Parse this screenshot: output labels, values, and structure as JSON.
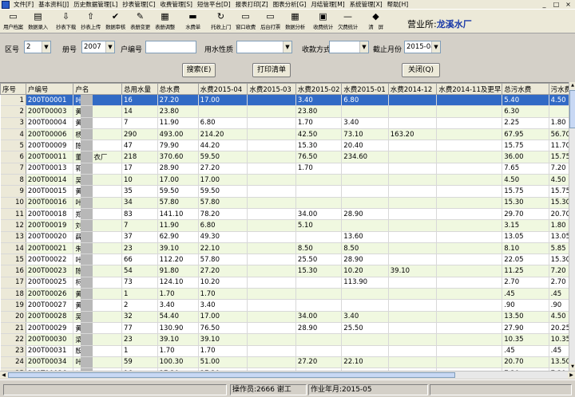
{
  "menu": [
    "文件[F]",
    "基本资料[J]",
    "历史数据管理[L]",
    "抄表管理[C]",
    "收费管理[S]",
    "短信平台[D]",
    "报表打印[Z]",
    "图表分析[G]",
    "月结管理[M]",
    "系统管理[X]",
    "帮助[H]"
  ],
  "window_buttons": [
    "_",
    "□",
    "×"
  ],
  "toolbar": [
    {
      "icon": "user-file-icon",
      "glyph": "▭",
      "label": "用户档案"
    },
    {
      "icon": "data-entry-icon",
      "glyph": "▤",
      "label": "数据录入"
    },
    {
      "icon": "download-icon",
      "glyph": "⇩",
      "label": "抄表下载"
    },
    {
      "icon": "upload-icon",
      "glyph": "⇧",
      "label": "抄表上传"
    },
    {
      "icon": "audit-icon",
      "glyph": "✔",
      "label": "数据审核"
    },
    {
      "icon": "table-change-icon",
      "glyph": "✎",
      "label": "表册变更"
    },
    {
      "icon": "table-adjust-icon",
      "glyph": "▦",
      "label": "表册调整"
    },
    {
      "icon": "water-bill-icon",
      "glyph": "▬",
      "label": "水费单"
    },
    {
      "icon": "door-to-door-icon",
      "glyph": "↻",
      "label": "托收上门"
    },
    {
      "icon": "window-charge-icon",
      "glyph": "▭",
      "label": "窗口收费"
    },
    {
      "icon": "backend-print-icon",
      "glyph": "▭",
      "label": "后台打票"
    },
    {
      "icon": "data-analysis-icon",
      "glyph": "▦",
      "label": "数据分析"
    },
    {
      "icon": "charge-stats-icon",
      "glyph": "▣",
      "label": "收费统计"
    },
    {
      "icon": "arrears-stats-icon",
      "glyph": "—",
      "label": "欠费统计"
    },
    {
      "icon": "clear-screen-icon",
      "glyph": "◆",
      "label": "清　屏"
    }
  ],
  "company": {
    "prefix": "营业所:",
    "name": "龙溪水厂"
  },
  "filters": {
    "district_label": "区号",
    "district_value": "2",
    "book_label": "册号",
    "book_value": "2007",
    "user_no_label": "户编号",
    "user_no_value": "",
    "water_type_label": "用水性质",
    "water_type_value": "",
    "pay_method_label": "收款方式",
    "pay_method_value": "",
    "month_label": "截止月份",
    "month_value": "2015-04"
  },
  "buttons": {
    "search": "搜索(E)",
    "print": "打印清单",
    "close": "关闭(Q)"
  },
  "table": {
    "columns": [
      "序号",
      "户编号",
      "户名",
      "总用水量",
      "总水费",
      "水费2015-04",
      "水费2015-03",
      "水费2015-02",
      "水费2015-01",
      "水费2014-12",
      "水费2014-11及更早",
      "总污水费",
      "污水费2015-0"
    ],
    "rows": [
      [
        "1",
        "200T00001",
        "叶",
        "16",
        "27.20",
        "17.00",
        "",
        "3.40",
        "6.80",
        "",
        "",
        "5.40",
        "4.50"
      ],
      [
        "2",
        "200T00003",
        "黄",
        "14",
        "23.80",
        "",
        "",
        "23.80",
        "",
        "",
        "",
        "6.30",
        ""
      ],
      [
        "3",
        "200T00004",
        "黄",
        "7",
        "11.90",
        "6.80",
        "",
        "1.70",
        "3.40",
        "",
        "",
        "2.25",
        "1.80"
      ],
      [
        "4",
        "200T00006",
        "杨",
        "290",
        "493.00",
        "214.20",
        "",
        "42.50",
        "73.10",
        "163.20",
        "",
        "67.95",
        "56.70"
      ],
      [
        "5",
        "200T00009",
        "陈",
        "47",
        "79.90",
        "44.20",
        "",
        "15.30",
        "20.40",
        "",
        "",
        "15.75",
        "11.70"
      ],
      [
        "6",
        "200T00011",
        "董",
        "218",
        "370.60",
        "59.50",
        "",
        "76.50",
        "234.60",
        "",
        "",
        "36.00",
        "15.75"
      ],
      [
        "7",
        "200T00013",
        "郭",
        "17",
        "28.90",
        "27.20",
        "",
        "1.70",
        "",
        "",
        "",
        "7.65",
        "7.20"
      ],
      [
        "8",
        "200T00014",
        "吴",
        "10",
        "17.00",
        "17.00",
        "",
        "",
        "",
        "",
        "",
        "4.50",
        "4.50"
      ],
      [
        "9",
        "200T00015",
        "黄",
        "35",
        "59.50",
        "59.50",
        "",
        "",
        "",
        "",
        "",
        "15.75",
        "15.75"
      ],
      [
        "10",
        "200T00016",
        "叶",
        "34",
        "57.80",
        "57.80",
        "",
        "",
        "",
        "",
        "",
        "15.30",
        "15.30"
      ],
      [
        "11",
        "200T00018",
        "郑",
        "83",
        "141.10",
        "78.20",
        "",
        "34.00",
        "28.90",
        "",
        "",
        "29.70",
        "20.70"
      ],
      [
        "12",
        "200T00019",
        "刘",
        "7",
        "11.90",
        "6.80",
        "",
        "5.10",
        "",
        "",
        "",
        "3.15",
        "1.80"
      ],
      [
        "13",
        "200T00020",
        "薛",
        "37",
        "62.90",
        "49.30",
        "",
        "",
        "13.60",
        "",
        "",
        "13.05",
        "13.05"
      ],
      [
        "14",
        "200T00021",
        "朱",
        "23",
        "39.10",
        "22.10",
        "",
        "8.50",
        "8.50",
        "",
        "",
        "8.10",
        "5.85"
      ],
      [
        "15",
        "200T00022",
        "叶",
        "66",
        "112.20",
        "57.80",
        "",
        "25.50",
        "28.90",
        "",
        "",
        "22.05",
        "15.30"
      ],
      [
        "16",
        "200T00023",
        "陈",
        "54",
        "91.80",
        "27.20",
        "",
        "15.30",
        "10.20",
        "39.10",
        "",
        "11.25",
        "7.20"
      ],
      [
        "17",
        "200T00025",
        "柯",
        "73",
        "124.10",
        "10.20",
        "",
        "",
        "113.90",
        "",
        "",
        "2.70",
        "2.70"
      ],
      [
        "18",
        "200T00026",
        "黄",
        "1",
        "1.70",
        "1.70",
        "",
        "",
        "",
        "",
        "",
        ".45",
        ".45"
      ],
      [
        "19",
        "200T00027",
        "黄",
        "2",
        "3.40",
        "3.40",
        "",
        "",
        "",
        "",
        "",
        ".90",
        ".90"
      ],
      [
        "20",
        "200T00028",
        "吴",
        "32",
        "54.40",
        "17.00",
        "",
        "34.00",
        "3.40",
        "",
        "",
        "13.50",
        "4.50"
      ],
      [
        "21",
        "200T00029",
        "黄",
        "77",
        "130.90",
        "76.50",
        "",
        "28.90",
        "25.50",
        "",
        "",
        "27.90",
        "20.25"
      ],
      [
        "22",
        "200T00030",
        "梁",
        "23",
        "39.10",
        "39.10",
        "",
        "",
        "",
        "",
        "",
        "10.35",
        "10.35"
      ],
      [
        "23",
        "200T00031",
        "殷",
        "1",
        "1.70",
        "1.70",
        "",
        "",
        "",
        "",
        "",
        ".45",
        ".45"
      ],
      [
        "24",
        "200T00034",
        "叶",
        "59",
        "100.30",
        "51.00",
        "",
        "27.20",
        "22.10",
        "",
        "",
        "20.70",
        "13.50"
      ],
      [
        "25",
        "200T00036",
        "郭",
        "16",
        "27.20",
        "27.20",
        "",
        "",
        "",
        "",
        "",
        "7.20",
        "7.20"
      ]
    ],
    "row6_name_suffix": "衣厂"
  },
  "status": {
    "operator": "操作员:2666 谢工",
    "work_month": "作业年月:2015-05"
  },
  "colors": {
    "selected_row": "#316ac5",
    "even_row": "#f0f8e0",
    "company_name": "#1a3aa8"
  }
}
